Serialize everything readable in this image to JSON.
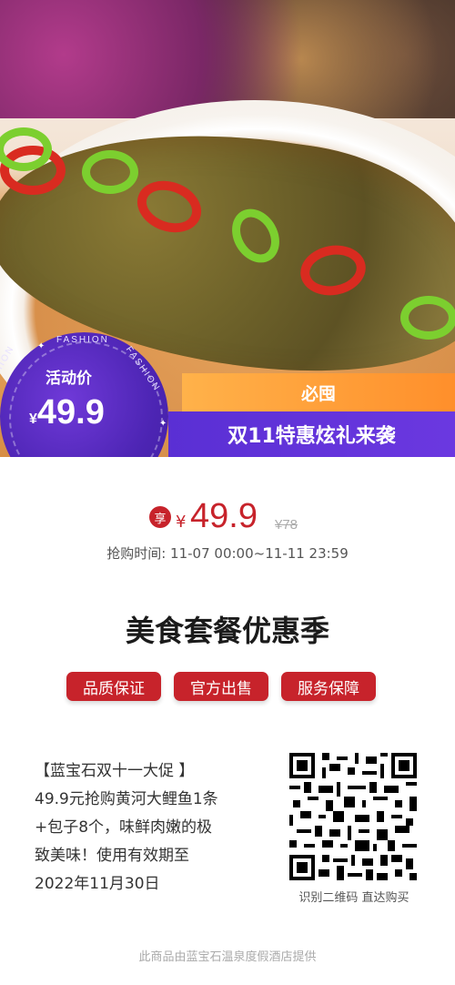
{
  "badge": {
    "ring_words": [
      "FASHION",
      "FASHION",
      "FASHION"
    ],
    "label": "活动价",
    "currency": "¥",
    "price": "49.9"
  },
  "banner": {
    "top_text": "必囤",
    "main_text": "双11特惠炫礼来袭"
  },
  "price": {
    "share_icon_label": "享",
    "currency": "¥",
    "current": "49.9",
    "original": "¥78"
  },
  "time_text": "抢购时间: 11-07 00:00~11-11 23:59",
  "title": "美食套餐优惠季",
  "tags": [
    "品质保证",
    "官方出售",
    "服务保障"
  ],
  "description_lines": [
    "【蓝宝石双十一大促 】",
    "49.9元抢购黄河大鲤鱼1条",
    "+包子8个，味鲜肉嫩的极",
    "致美味！使用有效期至",
    "2022年11月30日"
  ],
  "qr_caption": "识别二维码 直达购买",
  "footer": "此商品由蓝宝石温泉度假酒店提供",
  "colors": {
    "accent_red": "#c7232b",
    "purple": "#5a2fd4",
    "orange": "#ff9a2f"
  }
}
